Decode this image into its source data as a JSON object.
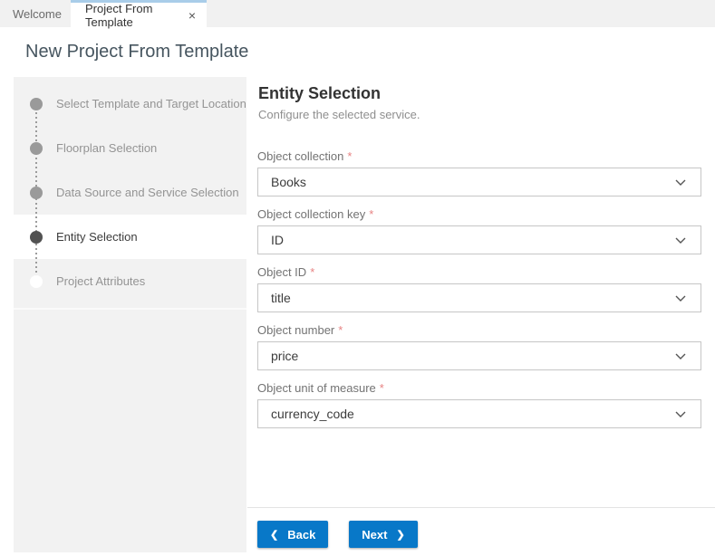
{
  "tabs": [
    {
      "label": "Welcome",
      "active": false
    },
    {
      "label": "Project From Template",
      "active": true,
      "close_icon": "×"
    }
  ],
  "page_title": "New Project From Template",
  "wizard": {
    "steps": [
      {
        "label": "Select Template and Target Location",
        "state": "completed"
      },
      {
        "label": "Floorplan Selection",
        "state": "completed"
      },
      {
        "label": "Data Source and Service Selection",
        "state": "completed"
      },
      {
        "label": "Entity Selection",
        "state": "active"
      },
      {
        "label": "Project Attributes",
        "state": "upcoming"
      }
    ]
  },
  "panel": {
    "title": "Entity Selection",
    "subtitle": "Configure the selected service.",
    "required_marker": "*",
    "fields": [
      {
        "label": "Object collection",
        "required": true,
        "value": "Books"
      },
      {
        "label": "Object collection key",
        "required": true,
        "value": "ID"
      },
      {
        "label": "Object ID",
        "required": true,
        "value": "title"
      },
      {
        "label": "Object number",
        "required": true,
        "value": "price"
      },
      {
        "label": "Object unit of measure",
        "required": true,
        "value": "currency_code"
      }
    ],
    "buttons": {
      "back": "Back",
      "next": "Next",
      "back_chevron": "❮",
      "next_chevron": "❯"
    }
  },
  "colors": {
    "accent_blue": "#0878c8",
    "tab_highlight_blue": "#a9cde9",
    "required_red": "#e78383",
    "sidebar_gray": "#f2f2f2"
  }
}
